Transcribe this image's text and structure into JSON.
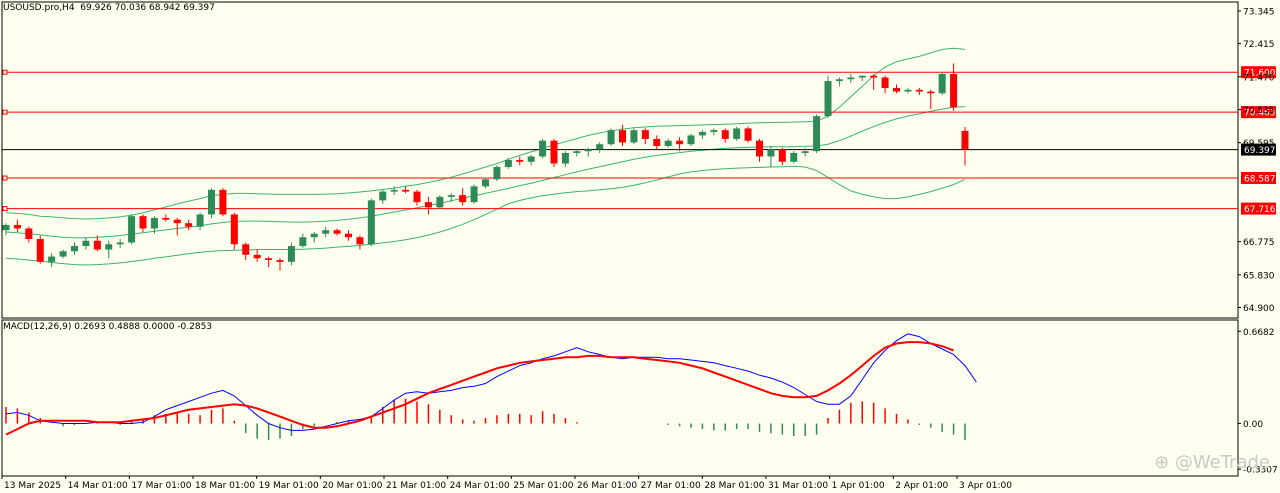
{
  "header": {
    "symbol": "USOUSD.pro,H4",
    "ohlc": "69.926 70.036 68.942 69.397"
  },
  "macd_header": {
    "label": "MACD(12,26,9)",
    "values": "0.2693 0.4888 0.0000 -0.2853"
  },
  "watermark": "@WeTrade",
  "colors": {
    "background": "#fffff0",
    "bull": "#2e8b57",
    "bear": "#ff0000",
    "bands": "#3cb371",
    "hline": "#ff0000",
    "macd_line": "#0000ff",
    "signal_line": "#ff0000"
  },
  "chart_data": [
    {
      "type": "candlestick",
      "title": "USOUSD.pro,H4",
      "ylim": [
        64.6,
        73.6
      ],
      "y_ticks": [
        "73.345",
        "72.415",
        "71.470",
        "70.535",
        "69.595",
        "66.775",
        "65.830",
        "64.900"
      ],
      "current_price": "69.397",
      "hlines": [
        "71.600",
        "70.463",
        "68.587",
        "67.716"
      ],
      "x_labels": [
        "13 Mar 2025",
        "14 Mar 01:00",
        "17 Mar 01:00",
        "18 Mar 01:00",
        "19 Mar 01:00",
        "20 Mar 01:00",
        "21 Mar 01:00",
        "24 Mar 01:00",
        "25 Mar 01:00",
        "26 Mar 01:00",
        "27 Mar 01:00",
        "28 Mar 01:00",
        "31 Mar 01:00",
        "1 Apr 01:00",
        "2 Apr 01:00",
        "3 Apr 01:00"
      ],
      "candles": [
        [
          67.1,
          67.3,
          66.95,
          67.25
        ],
        [
          67.25,
          67.4,
          67.05,
          67.15
        ],
        [
          67.15,
          67.2,
          66.75,
          66.85
        ],
        [
          66.85,
          66.95,
          66.15,
          66.2
        ],
        [
          66.2,
          66.45,
          66.05,
          66.35
        ],
        [
          66.35,
          66.55,
          66.3,
          66.5
        ],
        [
          66.5,
          66.75,
          66.4,
          66.65
        ],
        [
          66.65,
          66.9,
          66.55,
          66.8
        ],
        [
          66.8,
          66.95,
          66.5,
          66.55
        ],
        [
          66.55,
          66.8,
          66.3,
          66.7
        ],
        [
          66.7,
          66.85,
          66.6,
          66.75
        ],
        [
          66.75,
          67.55,
          66.7,
          67.5
        ],
        [
          67.5,
          67.55,
          67.05,
          67.15
        ],
        [
          67.15,
          67.5,
          67.0,
          67.45
        ],
        [
          67.45,
          67.55,
          67.35,
          67.4
        ],
        [
          67.4,
          67.45,
          66.95,
          67.3
        ],
        [
          67.3,
          67.4,
          67.1,
          67.2
        ],
        [
          67.2,
          67.6,
          67.1,
          67.55
        ],
        [
          67.55,
          68.3,
          67.45,
          68.25
        ],
        [
          68.25,
          68.3,
          67.5,
          67.55
        ],
        [
          67.55,
          67.6,
          66.55,
          66.7
        ],
        [
          66.7,
          66.75,
          66.25,
          66.4
        ],
        [
          66.4,
          66.55,
          66.2,
          66.3
        ],
        [
          66.3,
          66.35,
          66.05,
          66.25
        ],
        [
          66.25,
          66.3,
          65.95,
          66.2
        ],
        [
          66.2,
          66.75,
          66.1,
          66.65
        ],
        [
          66.65,
          67.0,
          66.6,
          66.9
        ],
        [
          66.9,
          67.05,
          66.75,
          67.0
        ],
        [
          67.0,
          67.2,
          66.9,
          67.1
        ],
        [
          67.1,
          67.15,
          66.95,
          67.0
        ],
        [
          67.0,
          67.1,
          66.8,
          66.9
        ],
        [
          66.9,
          66.95,
          66.55,
          66.7
        ],
        [
          66.7,
          68.0,
          66.65,
          67.95
        ],
        [
          67.95,
          68.25,
          67.85,
          68.2
        ],
        [
          68.2,
          68.35,
          68.1,
          68.25
        ],
        [
          68.25,
          68.35,
          68.15,
          68.2
        ],
        [
          68.2,
          68.25,
          67.8,
          67.9
        ],
        [
          67.9,
          68.05,
          67.55,
          67.75
        ],
        [
          67.75,
          68.1,
          67.7,
          68.05
        ],
        [
          68.05,
          68.15,
          67.9,
          68.1
        ],
        [
          68.1,
          68.3,
          67.8,
          67.9
        ],
        [
          67.9,
          68.4,
          67.85,
          68.35
        ],
        [
          68.35,
          68.6,
          68.3,
          68.55
        ],
        [
          68.55,
          68.95,
          68.5,
          68.9
        ],
        [
          68.9,
          69.15,
          68.85,
          69.1
        ],
        [
          69.1,
          69.2,
          68.95,
          69.05
        ],
        [
          69.05,
          69.25,
          68.95,
          69.2
        ],
        [
          69.2,
          69.7,
          69.15,
          69.65
        ],
        [
          69.65,
          69.7,
          68.9,
          69.0
        ],
        [
          69.0,
          69.35,
          68.9,
          69.3
        ],
        [
          69.3,
          69.4,
          69.2,
          69.35
        ],
        [
          69.35,
          69.45,
          69.2,
          69.4
        ],
        [
          69.4,
          69.6,
          69.3,
          69.55
        ],
        [
          69.55,
          70.0,
          69.5,
          69.95
        ],
        [
          69.95,
          70.1,
          69.5,
          69.6
        ],
        [
          69.6,
          70.0,
          69.55,
          69.95
        ],
        [
          69.95,
          70.0,
          69.55,
          69.7
        ],
        [
          69.7,
          69.8,
          69.4,
          69.5
        ],
        [
          69.5,
          69.7,
          69.45,
          69.65
        ],
        [
          69.65,
          69.75,
          69.35,
          69.55
        ],
        [
          69.55,
          69.85,
          69.5,
          69.8
        ],
        [
          69.8,
          69.95,
          69.7,
          69.9
        ],
        [
          69.9,
          70.0,
          69.8,
          69.95
        ],
        [
          69.95,
          70.0,
          69.6,
          69.7
        ],
        [
          69.7,
          70.05,
          69.65,
          70.0
        ],
        [
          70.0,
          70.05,
          69.6,
          69.65
        ],
        [
          69.65,
          69.7,
          69.05,
          69.2
        ],
        [
          69.2,
          69.5,
          68.9,
          69.4
        ],
        [
          69.4,
          69.45,
          68.95,
          69.05
        ],
        [
          69.05,
          69.35,
          69.0,
          69.3
        ],
        [
          69.3,
          69.45,
          69.2,
          69.35
        ],
        [
          69.35,
          70.4,
          69.3,
          70.35
        ],
        [
          70.35,
          71.5,
          70.3,
          71.35
        ],
        [
          71.35,
          71.45,
          71.2,
          71.4
        ],
        [
          71.4,
          71.55,
          71.3,
          71.45
        ],
        [
          71.45,
          71.5,
          71.35,
          71.5
        ],
        [
          71.5,
          71.55,
          71.1,
          71.45
        ],
        [
          71.45,
          71.5,
          71.0,
          71.15
        ],
        [
          71.15,
          71.25,
          71.0,
          71.05
        ],
        [
          71.05,
          71.15,
          71.0,
          71.1
        ],
        [
          71.1,
          71.15,
          70.95,
          71.05
        ],
        [
          71.05,
          71.1,
          70.55,
          71.0
        ],
        [
          71.0,
          71.6,
          70.95,
          71.55
        ],
        [
          71.55,
          71.85,
          70.5,
          70.6
        ],
        [
          69.93,
          70.04,
          68.94,
          69.4
        ]
      ],
      "upper_band": [
        67.6,
        67.58,
        67.55,
        67.5,
        67.48,
        67.45,
        67.43,
        67.42,
        67.43,
        67.45,
        67.48,
        67.53,
        67.6,
        67.68,
        67.76,
        67.85,
        67.93,
        68.0,
        68.08,
        68.12,
        68.15,
        68.15,
        68.14,
        68.13,
        68.12,
        68.12,
        68.12,
        68.12,
        68.13,
        68.14,
        68.16,
        68.19,
        68.22,
        68.26,
        68.3,
        68.35,
        68.4,
        68.46,
        68.53,
        68.61,
        68.7,
        68.8,
        68.9,
        69.0,
        69.12,
        69.23,
        69.33,
        69.43,
        69.53,
        69.62,
        69.71,
        69.8,
        69.87,
        69.93,
        69.98,
        70.02,
        70.04,
        70.06,
        70.07,
        70.08,
        70.09,
        70.1,
        70.11,
        70.12,
        70.13,
        70.15,
        70.16,
        70.17,
        70.17,
        70.18,
        70.19,
        70.2,
        70.35,
        70.6,
        70.9,
        71.2,
        71.5,
        71.75,
        71.9,
        71.98,
        72.05,
        72.15,
        72.25,
        72.28,
        72.25
      ],
      "middle_band": [
        67.05,
        67.03,
        67.0,
        66.97,
        66.93,
        66.9,
        66.88,
        66.88,
        66.9,
        66.92,
        66.95,
        66.99,
        67.03,
        67.07,
        67.11,
        67.15,
        67.19,
        67.23,
        67.28,
        67.32,
        67.35,
        67.36,
        67.36,
        67.35,
        67.34,
        67.33,
        67.33,
        67.34,
        67.36,
        67.38,
        67.41,
        67.45,
        67.5,
        67.56,
        67.62,
        67.68,
        67.74,
        67.8,
        67.87,
        67.94,
        68.01,
        68.08,
        68.15,
        68.22,
        68.29,
        68.37,
        68.44,
        68.52,
        68.6,
        68.68,
        68.76,
        68.84,
        68.91,
        68.98,
        69.05,
        69.12,
        69.18,
        69.23,
        69.27,
        69.31,
        69.35,
        69.38,
        69.41,
        69.43,
        69.45,
        69.46,
        69.47,
        69.48,
        69.48,
        69.48,
        69.49,
        69.5,
        69.55,
        69.65,
        69.78,
        69.92,
        70.05,
        70.17,
        70.27,
        70.35,
        70.42,
        70.49,
        70.55,
        70.6,
        70.62
      ],
      "lower_band": [
        66.3,
        66.28,
        66.25,
        66.22,
        66.18,
        66.15,
        66.12,
        66.11,
        66.12,
        66.14,
        66.17,
        66.21,
        66.25,
        66.3,
        66.34,
        66.39,
        66.43,
        66.47,
        66.5,
        66.52,
        66.53,
        66.54,
        66.55,
        66.55,
        66.55,
        66.55,
        66.56,
        66.57,
        66.59,
        66.62,
        66.64,
        66.67,
        66.7,
        66.74,
        66.78,
        66.83,
        66.89,
        66.96,
        67.05,
        67.15,
        67.27,
        67.4,
        67.55,
        67.7,
        67.85,
        67.95,
        68.02,
        68.08,
        68.13,
        68.17,
        68.2,
        68.22,
        68.25,
        68.28,
        68.32,
        68.38,
        68.45,
        68.53,
        68.62,
        68.7,
        68.76,
        68.8,
        68.83,
        68.85,
        68.87,
        68.88,
        68.89,
        68.9,
        68.91,
        68.92,
        68.9,
        68.8,
        68.6,
        68.4,
        68.22,
        68.12,
        68.05,
        68.0,
        68.0,
        68.05,
        68.12,
        68.2,
        68.3,
        68.4,
        68.55
      ]
    },
    {
      "type": "macd",
      "title": "MACD(12,26,9)",
      "ylim": [
        -0.38,
        0.75
      ],
      "y_ticks": [
        "0.6682",
        "0.00",
        "-0.3307"
      ],
      "histogram": [
        0.12,
        0.11,
        0.08,
        0.04,
        0.0,
        -0.02,
        -0.01,
        0.0,
        0.01,
        0.0,
        -0.01,
        0.02,
        0.03,
        0.06,
        0.07,
        0.08,
        0.07,
        0.06,
        0.1,
        0.11,
        0.02,
        -0.07,
        -0.11,
        -0.12,
        -0.11,
        -0.09,
        -0.04,
        -0.02,
        0.0,
        0.01,
        0.02,
        0.0,
        0.05,
        0.12,
        0.17,
        0.18,
        0.16,
        0.14,
        0.1,
        0.06,
        0.03,
        0.02,
        0.04,
        0.06,
        0.07,
        0.07,
        0.06,
        0.09,
        0.07,
        0.04,
        0.01,
        0.0,
        0.0,
        0.0,
        0.0,
        0.0,
        0.0,
        0.0,
        -0.01,
        -0.02,
        -0.03,
        -0.04,
        -0.05,
        -0.05,
        -0.04,
        -0.04,
        -0.06,
        -0.07,
        -0.08,
        -0.09,
        -0.09,
        -0.08,
        0.04,
        0.1,
        0.15,
        0.16,
        0.15,
        0.11,
        0.07,
        0.03,
        -0.01,
        -0.03,
        -0.06,
        -0.08,
        -0.12
      ],
      "macd_line": [
        0.07,
        0.08,
        0.06,
        0.02,
        0.01,
        0.0,
        0.0,
        0.0,
        0.01,
        0.01,
        0.0,
        0.0,
        0.01,
        0.05,
        0.1,
        0.13,
        0.16,
        0.19,
        0.22,
        0.24,
        0.2,
        0.13,
        0.06,
        0.0,
        -0.03,
        -0.05,
        -0.05,
        -0.04,
        -0.02,
        0.0,
        0.02,
        0.03,
        0.05,
        0.11,
        0.17,
        0.22,
        0.23,
        0.22,
        0.23,
        0.24,
        0.26,
        0.27,
        0.29,
        0.34,
        0.38,
        0.42,
        0.44,
        0.47,
        0.49,
        0.52,
        0.55,
        0.52,
        0.5,
        0.48,
        0.47,
        0.48,
        0.48,
        0.48,
        0.47,
        0.47,
        0.46,
        0.45,
        0.44,
        0.42,
        0.4,
        0.38,
        0.35,
        0.33,
        0.3,
        0.26,
        0.21,
        0.16,
        0.14,
        0.14,
        0.2,
        0.32,
        0.44,
        0.53,
        0.6,
        0.65,
        0.63,
        0.58,
        0.54,
        0.5,
        0.42,
        0.3
      ],
      "signal_line": [
        -0.08,
        -0.04,
        0.0,
        0.02,
        0.02,
        0.02,
        0.02,
        0.02,
        0.01,
        0.01,
        0.01,
        0.02,
        0.03,
        0.04,
        0.06,
        0.08,
        0.1,
        0.11,
        0.12,
        0.13,
        0.14,
        0.13,
        0.11,
        0.08,
        0.05,
        0.02,
        -0.01,
        -0.03,
        -0.03,
        -0.02,
        0.0,
        0.02,
        0.05,
        0.08,
        0.11,
        0.14,
        0.18,
        0.22,
        0.25,
        0.28,
        0.31,
        0.34,
        0.37,
        0.4,
        0.42,
        0.44,
        0.45,
        0.46,
        0.47,
        0.48,
        0.48,
        0.49,
        0.49,
        0.48,
        0.48,
        0.48,
        0.47,
        0.46,
        0.45,
        0.44,
        0.42,
        0.4,
        0.37,
        0.34,
        0.31,
        0.28,
        0.25,
        0.22,
        0.2,
        0.19,
        0.19,
        0.2,
        0.24,
        0.29,
        0.35,
        0.42,
        0.49,
        0.55,
        0.58,
        0.59,
        0.59,
        0.58,
        0.56,
        0.53
      ]
    }
  ]
}
